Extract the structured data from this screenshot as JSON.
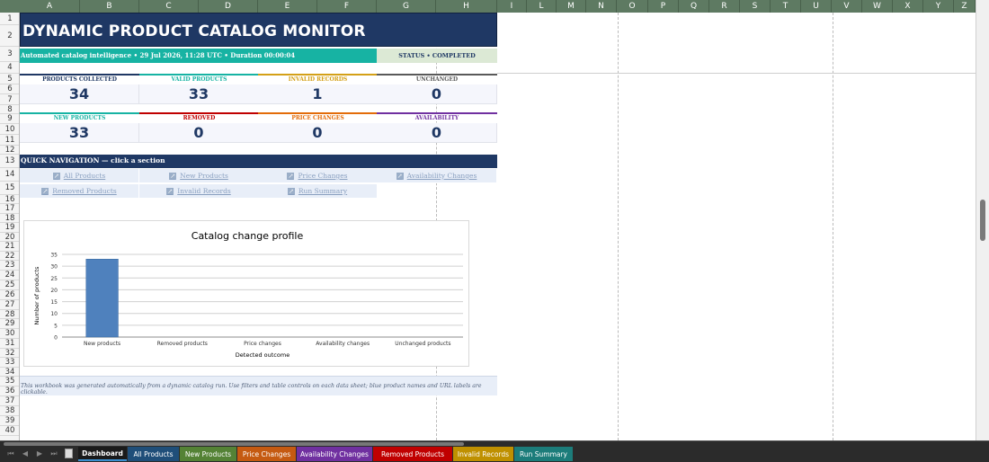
{
  "columns": [
    "A",
    "B",
    "C",
    "D",
    "E",
    "F",
    "G",
    "H",
    "I",
    "L",
    "M",
    "N",
    "O",
    "P",
    "Q",
    "R",
    "S",
    "T",
    "U",
    "V",
    "W",
    "X",
    "Y",
    "Z"
  ],
  "rows": [
    "1",
    "2",
    "3",
    "4",
    "5",
    "6",
    "7",
    "8",
    "9",
    "10",
    "11",
    "12",
    "13",
    "14",
    "15",
    "16",
    "17",
    "18",
    "19",
    "20",
    "21",
    "22",
    "23",
    "24",
    "25",
    "26",
    "27",
    "28",
    "29",
    "30",
    "31",
    "32",
    "33",
    "34",
    "35",
    "36",
    "37",
    "38",
    "39",
    "40"
  ],
  "title": "DYNAMIC PRODUCT CATALOG MONITOR",
  "subtitle": "Automated catalog intelligence  •  29 Jul 2026, 11:28 UTC  •  Duration 00:00:04",
  "status": "STATUS  •  COMPLETED",
  "kpis": [
    {
      "label": "PRODUCTS COLLECTED",
      "value": "34",
      "color": "#1f3864"
    },
    {
      "label": "VALID PRODUCTS",
      "value": "33",
      "color": "#17b3a3"
    },
    {
      "label": "INVALID RECORDS",
      "value": "1",
      "color": "#d4a017"
    },
    {
      "label": "UNCHANGED",
      "value": "0",
      "color": "#595959"
    },
    {
      "label": "NEW PRODUCTS",
      "value": "33",
      "color": "#17b3a3"
    },
    {
      "label": "REMOVED",
      "value": "0",
      "color": "#c00000"
    },
    {
      "label": "PRICE CHANGES",
      "value": "0",
      "color": "#e36c09"
    },
    {
      "label": "AVAILABILITY",
      "value": "0",
      "color": "#7030a0"
    }
  ],
  "nav_title": "QUICK NAVIGATION — click a section",
  "nav_links": [
    "All Products",
    "New Products",
    "Price Changes",
    "Availability Changes",
    "Removed Products",
    "Invalid Records",
    "Run Summary"
  ],
  "chart_data": {
    "type": "bar",
    "title": "Catalog change profile",
    "categories": [
      "New products",
      "Removed products",
      "Price changes",
      "Availability changes",
      "Unchanged products"
    ],
    "values": [
      33,
      0,
      0,
      0,
      0
    ],
    "xlabel": "Detected outcome",
    "ylabel": "Number of products",
    "ylim": [
      0,
      35
    ],
    "yticks": [
      "0",
      "5",
      "10",
      "15",
      "20",
      "25",
      "30",
      "35"
    ],
    "grid": true,
    "bar_color": "#4f81bd"
  },
  "footnote": "This workbook was generated automatically from a dynamic catalog run. Use filters and table controls on each data sheet; blue product names and URL labels are clickable.",
  "tabs": [
    {
      "label": "Dashboard",
      "color": "#1a1a1a",
      "active": true
    },
    {
      "label": "All Products",
      "color": "#1f4e79",
      "active": false
    },
    {
      "label": "New Products",
      "color": "#548235",
      "active": false
    },
    {
      "label": "Price Changes",
      "color": "#c55a11",
      "active": false
    },
    {
      "label": "Availability Changes",
      "color": "#7030a0",
      "active": false
    },
    {
      "label": "Removed Products",
      "color": "#c00000",
      "active": false
    },
    {
      "label": "Invalid Records",
      "color": "#bf9000",
      "active": false
    },
    {
      "label": "Run Summary",
      "color": "#1c7c7a",
      "active": false
    }
  ]
}
